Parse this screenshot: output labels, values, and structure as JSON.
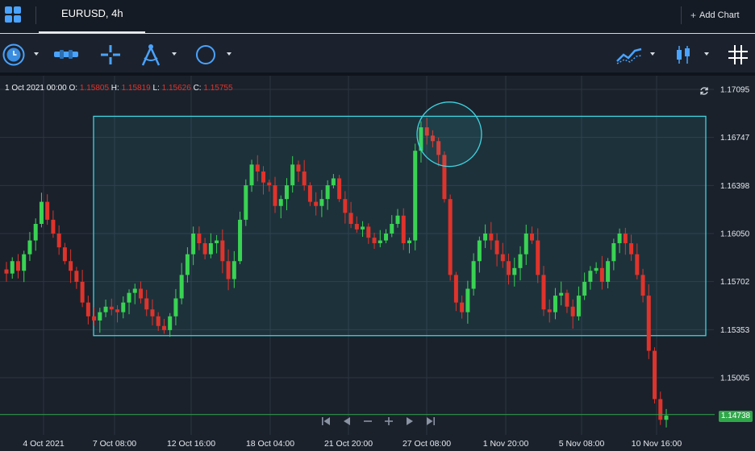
{
  "header": {
    "tab_title": "EURUSD, 4h",
    "add_chart_label": "Add Chart",
    "add_chart_icon": "plus-icon"
  },
  "toolbar": {
    "tools": [
      "timeframe-clock-icon",
      "horizontal-line-icon",
      "crosshair-icon",
      "fibonacci-compass-icon",
      "circle-shape-icon",
      "indicators-icon",
      "candles-type-icon",
      "grid-icon"
    ]
  },
  "ohlc": {
    "date": "1 Oct 2021 00:00",
    "o_label": "O:",
    "o": "1.15805",
    "h_label": "H:",
    "h": "1.15819",
    "l_label": "L:",
    "l": "1.15626",
    "c_label": "C:",
    "c": "1.15755"
  },
  "colors": {
    "up": "#39d353",
    "down": "#e0332b",
    "rect": "#3fd4e0",
    "last_line": "#2fa84a"
  },
  "price_axis": [
    "1.17095",
    "1.16747",
    "1.16398",
    "1.16050",
    "1.15702",
    "1.15353",
    "1.15005"
  ],
  "last_price": "1.14738",
  "chart_data": {
    "type": "candlestick",
    "symbol": "EURUSD",
    "timeframe": "4h",
    "x_ticks": [
      "4 Oct 2021",
      "7 Oct 08:00",
      "12 Oct 16:00",
      "18 Oct 04:00",
      "21 Oct 20:00",
      "27 Oct 08:00",
      "1 Nov 20:00",
      "5 Nov 08:00",
      "10 Nov 16:00"
    ],
    "y_ticks": [
      1.17095,
      1.16747,
      1.16398,
      1.1605,
      1.15702,
      1.15353,
      1.15005
    ],
    "ylim": [
      1.1464,
      1.1727
    ],
    "grid": true,
    "last_price": 1.14738,
    "rectangle": {
      "price_top": 1.169,
      "price_bottom": 1.1531
    },
    "circle_center_price": 1.1677,
    "close_path": [
      1.1576,
      1.1585,
      1.1578,
      1.159,
      1.16,
      1.1612,
      1.1628,
      1.1615,
      1.1605,
      1.1595,
      1.1585,
      1.1578,
      1.157,
      1.1555,
      1.1545,
      1.1542,
      1.1548,
      1.1552,
      1.155,
      1.1548,
      1.1555,
      1.1562,
      1.1565,
      1.1558,
      1.155,
      1.1545,
      1.1538,
      1.1535,
      1.1545,
      1.1558,
      1.1575,
      1.159,
      1.1605,
      1.1598,
      1.159,
      1.1598,
      1.16,
      1.1585,
      1.1572,
      1.1585,
      1.1615,
      1.164,
      1.1655,
      1.165,
      1.1642,
      1.164,
      1.1625,
      1.163,
      1.164,
      1.1655,
      1.165,
      1.164,
      1.1628,
      1.1625,
      1.163,
      1.164,
      1.1645,
      1.163,
      1.162,
      1.1612,
      1.1608,
      1.161,
      1.1602,
      1.1598,
      1.16,
      1.1605,
      1.1612,
      1.1618,
      1.1598,
      1.16,
      1.1665,
      1.1682,
      1.1676,
      1.1672,
      1.1662,
      1.163,
      1.1575,
      1.1555,
      1.1548,
      1.1565,
      1.1585,
      1.16,
      1.1605,
      1.16,
      1.159,
      1.1585,
      1.1575,
      1.158,
      1.159,
      1.1605,
      1.16,
      1.1575,
      1.155,
      1.1548,
      1.156,
      1.1562,
      1.1552,
      1.1545,
      1.156,
      1.157,
      1.1578,
      1.158,
      1.157,
      1.1585,
      1.1598,
      1.1605,
      1.1598,
      1.159,
      1.1575,
      1.156,
      1.152,
      1.1485,
      1.147,
      1.1473
    ]
  },
  "navigator": [
    "jump-start-icon",
    "scroll-left-icon",
    "zoom-out-icon",
    "zoom-in-icon",
    "scroll-right-icon",
    "jump-end-icon"
  ]
}
